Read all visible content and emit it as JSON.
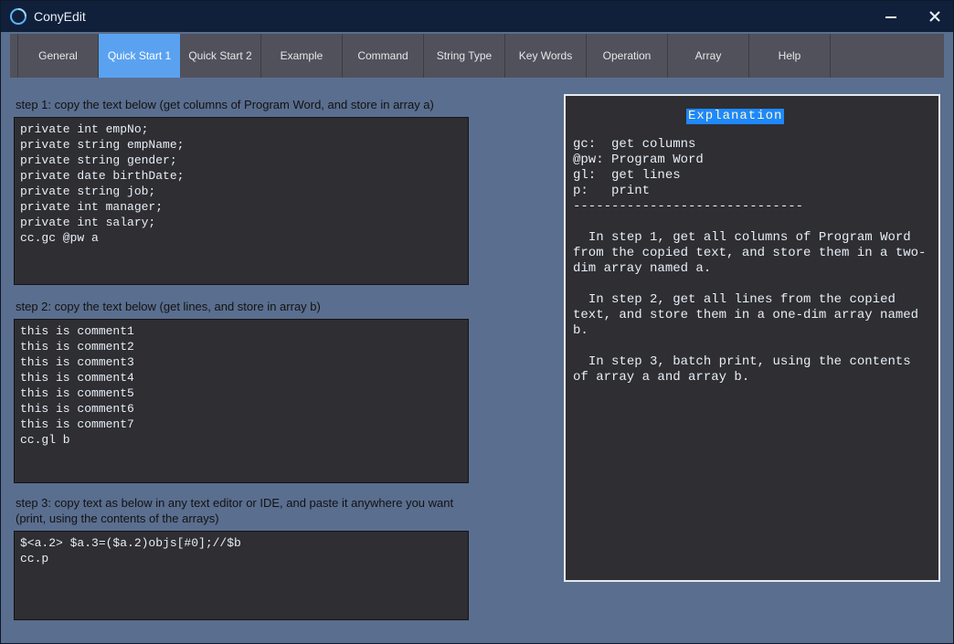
{
  "window": {
    "title": "ConyEdit"
  },
  "tabs": [
    {
      "label": "General"
    },
    {
      "label": "Quick Start 1",
      "active": true
    },
    {
      "label": "Quick Start 2"
    },
    {
      "label": "Example"
    },
    {
      "label": "Command"
    },
    {
      "label": "String Type"
    },
    {
      "label": "Key Words"
    },
    {
      "label": "Operation"
    },
    {
      "label": "Array"
    },
    {
      "label": "Help"
    }
  ],
  "steps": {
    "s1": {
      "label": "step 1:  copy the text below (get columns of Program Word, and store in array a)",
      "code": "private int empNo;\nprivate string empName;\nprivate string gender;\nprivate date birthDate;\nprivate string job;\nprivate int manager;\nprivate int salary;\ncc.gc @pw a"
    },
    "s2": {
      "label": "step 2: copy the text below (get lines, and store in array b)",
      "code": "this is comment1\nthis is comment2\nthis is comment3\nthis is comment4\nthis is comment5\nthis is comment6\nthis is comment7\ncc.gl b"
    },
    "s3": {
      "label": "step 3: copy text as below in any text editor or IDE, and paste it anywhere you want (print, using the contents of the arrays)",
      "code": "$<a.2> $a.3=($a.2)objs[#0];//$b\ncc.p"
    }
  },
  "explanation": {
    "title": "Explanation",
    "body": "gc:  get columns\n@pw: Program Word\ngl:  get lines\np:   print\n------------------------------\n\n  In step 1, get all columns of Program Word from the copied text, and store them in a two-dim array named a.\n\n  In step 2, get all lines from the copied text, and store them in a one-dim array named b.\n\n  In step 3, batch print, using the contents of array a and array b."
  }
}
